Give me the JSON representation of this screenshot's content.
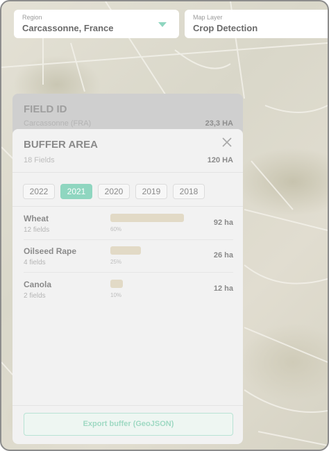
{
  "region": {
    "label": "Region",
    "value": "Carcassonne, France"
  },
  "map_layer": {
    "label": "Map Layer",
    "value": "Crop Detection"
  },
  "field_card": {
    "title": "FIELD ID",
    "location": "Carcassonne (FRA)",
    "area": "23,3 HA"
  },
  "buffer": {
    "title": "BUFFER AREA",
    "fields_count": "18 Fields",
    "area": "120 HA",
    "years": [
      "2022",
      "2021",
      "2020",
      "2019",
      "2018"
    ],
    "selected_year": "2021",
    "crops": [
      {
        "name": "Wheat",
        "fields": "12 fields",
        "percent_label": "60%",
        "percent": 60,
        "ha": "92 ha"
      },
      {
        "name": "Oilseed Rape",
        "fields": "4 fields",
        "percent_label": "25%",
        "percent": 25,
        "ha": "26 ha"
      },
      {
        "name": "Canola",
        "fields": "2 fields",
        "percent_label": "10%",
        "percent": 10,
        "ha": "12 ha"
      }
    ],
    "export_label": "Export buffer (GeoJSON)"
  },
  "colors": {
    "accent": "#8fd6c0",
    "bar": "#e2dac6"
  },
  "icons": {
    "dropdown": "chevron-down-icon",
    "close": "close-icon"
  }
}
